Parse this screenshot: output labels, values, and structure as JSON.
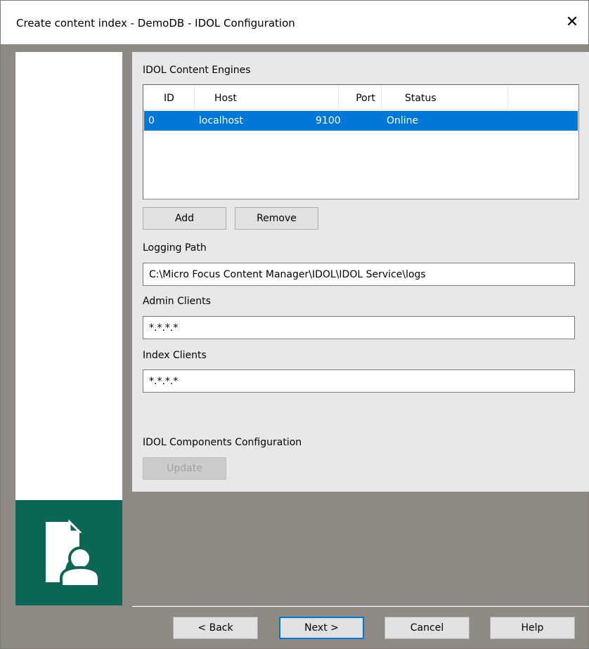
{
  "window": {
    "title": "Create content index - DemoDB - IDOL Configuration",
    "close_glyph": "✕"
  },
  "engines": {
    "label": "IDOL Content Engines",
    "columns": [
      "ID",
      "Host",
      "Port",
      "Status"
    ],
    "rows": [
      {
        "id": "0",
        "host": "localhost",
        "port": "9100",
        "status": "Online",
        "selected": true
      }
    ],
    "add_label": "Add",
    "remove_label": "Remove"
  },
  "logging": {
    "label": "Logging Path",
    "value": "C:\\Micro Focus Content Manager\\IDOL\\IDOL Service\\logs"
  },
  "admin_clients": {
    "label": "Admin Clients",
    "value": "*.*.*.*"
  },
  "index_clients": {
    "label": "Index Clients",
    "value": "*.*.*.*"
  },
  "components": {
    "label": "IDOL Components Configuration",
    "update_label": "Update"
  },
  "footer": {
    "back_label": "< Back",
    "next_label": "Next >",
    "cancel_label": "Cancel",
    "help_label": "Help"
  },
  "icons": {
    "wizard": "document-user-icon"
  },
  "colors": {
    "accent": "#0078d7",
    "brand_green": "#0a6655",
    "background": "#8e8983"
  }
}
